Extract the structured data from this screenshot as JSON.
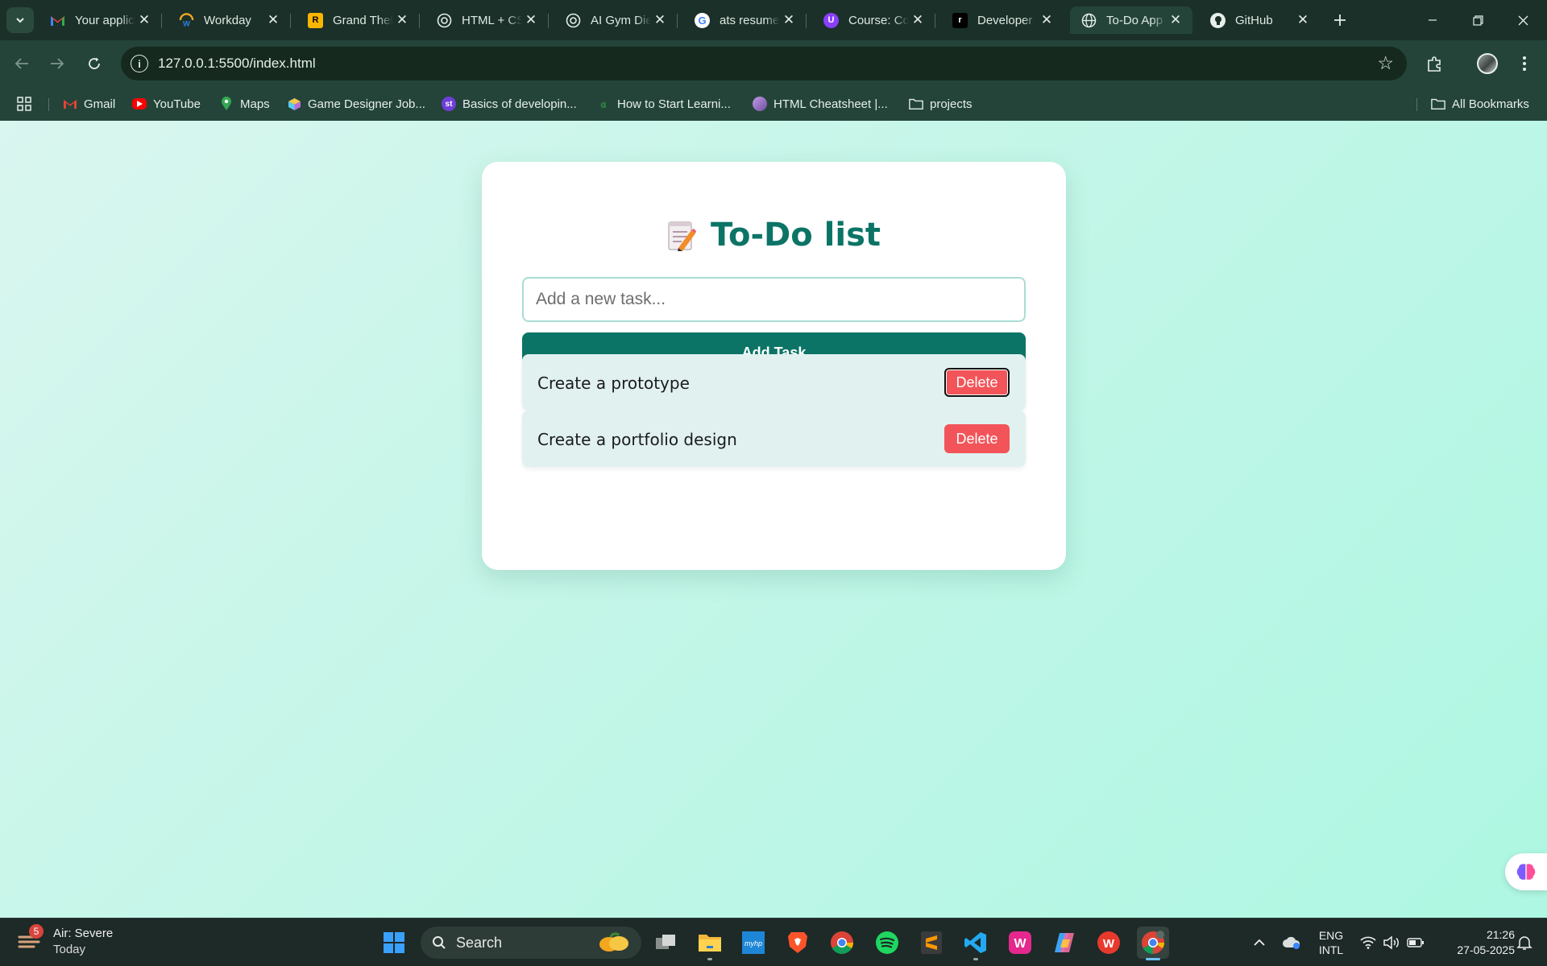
{
  "browser": {
    "tabs": [
      {
        "title": "Your application",
        "icon": "gmail-icon"
      },
      {
        "title": "Workday",
        "icon": "workday-icon"
      },
      {
        "title": "Grand Theft Auto",
        "icon": "rockstar-icon"
      },
      {
        "title": "HTML + CSS",
        "icon": "chatgpt-icon"
      },
      {
        "title": "AI Gym Diet",
        "icon": "chatgpt-icon"
      },
      {
        "title": "ats resume",
        "icon": "google-icon"
      },
      {
        "title": "Course: Co",
        "icon": "course-icon"
      },
      {
        "title": "Developer",
        "icon": "developer-icon"
      },
      {
        "title": "To-Do App",
        "icon": "globe-icon",
        "active": true
      },
      {
        "title": "GitHub",
        "icon": "github-icon"
      }
    ],
    "address": "127.0.0.1:5500/index.html",
    "bookmarks": [
      {
        "label": "Gmail",
        "icon": "gmail-icon"
      },
      {
        "label": "YouTube",
        "icon": "youtube-icon"
      },
      {
        "label": "Maps",
        "icon": "maps-icon"
      },
      {
        "label": "Game Designer Job...",
        "icon": "cube-icon"
      },
      {
        "label": "Basics of developin...",
        "icon": "st-icon"
      },
      {
        "label": "How to Start Learni...",
        "icon": "gfg-icon"
      },
      {
        "label": "HTML Cheatsheet |...",
        "icon": "avatar-icon"
      },
      {
        "label": "projects",
        "icon": "folder-icon"
      }
    ],
    "all_bookmarks": "All Bookmarks"
  },
  "app": {
    "title": "To-Do list",
    "input_placeholder": "Add a new task...",
    "add_button": "Add Task",
    "tasks": [
      {
        "text": "Create a prototype",
        "delete_label": "Delete"
      },
      {
        "text": "Create a portfolio design",
        "delete_label": "Delete"
      }
    ]
  },
  "taskbar": {
    "weather": {
      "title": "Air: Severe",
      "subtitle": "Today",
      "badge": "5"
    },
    "search_label": "Search",
    "lang_line1": "ENG",
    "lang_line2": "INTL",
    "time": "21:26",
    "date": "27-05-2025"
  },
  "colors": {
    "accent": "#0b7466",
    "delete": "#f25459",
    "task_bg": "#e0f1f0"
  }
}
